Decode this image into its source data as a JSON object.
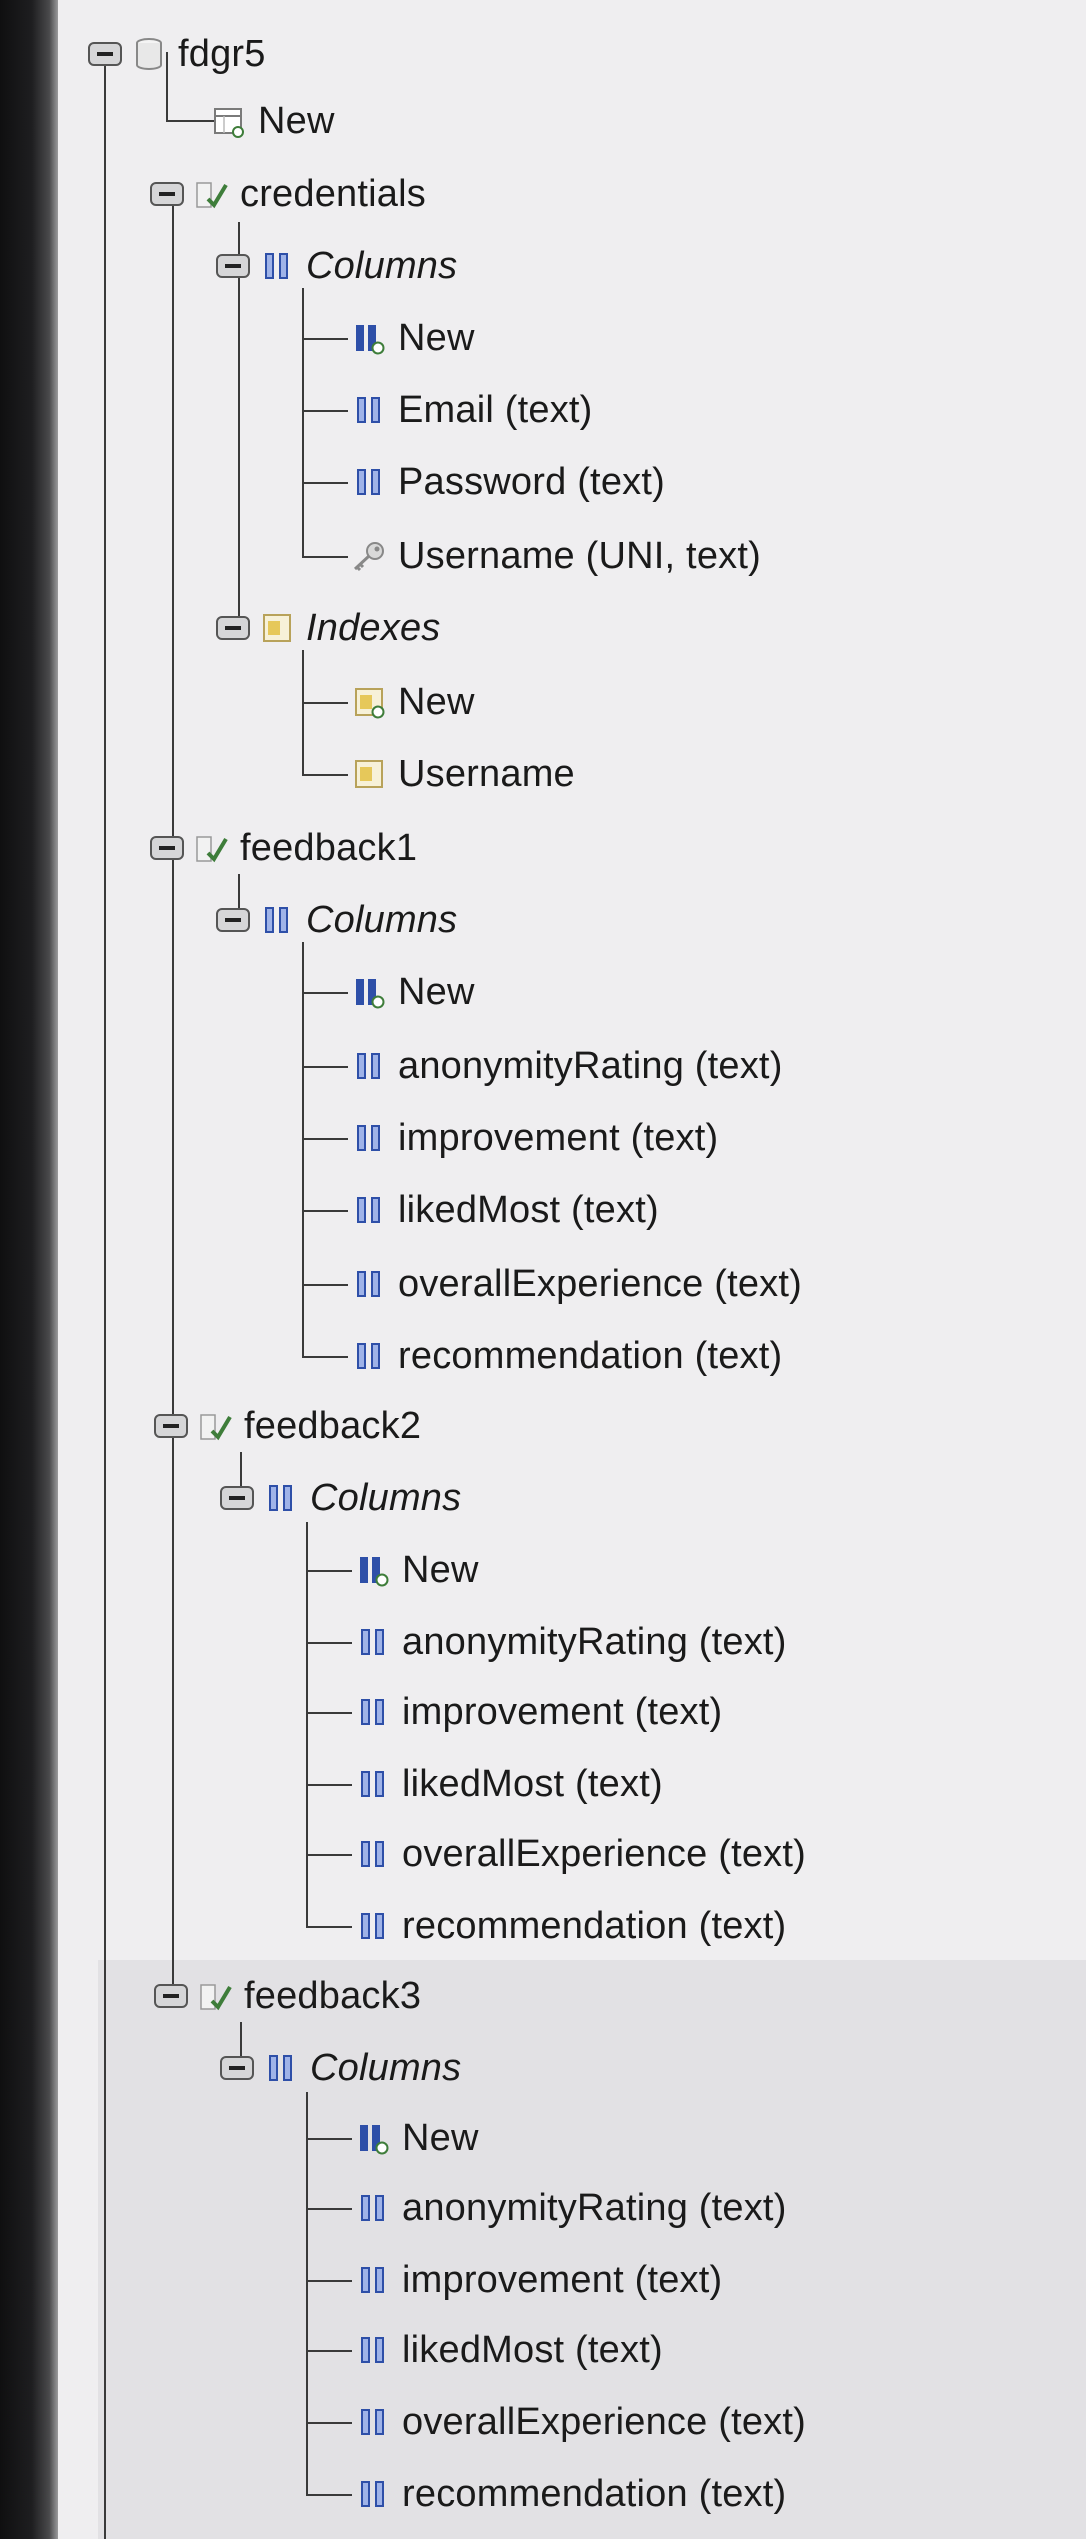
{
  "tree": {
    "root": {
      "label": "fdgr5"
    },
    "root_new": {
      "label": "New"
    },
    "tables": [
      {
        "name": "credentials",
        "columns_label": "Columns",
        "columns": [
          "New",
          "Email (text)",
          "Password (text)",
          "Username (UNI, text)"
        ],
        "indexes_label": "Indexes",
        "indexes": [
          "New",
          "Username"
        ]
      },
      {
        "name": "feedback1",
        "columns_label": "Columns",
        "columns": [
          "New",
          "anonymityRating (text)",
          "improvement (text)",
          "likedMost (text)",
          "overallExperience (text)",
          "recommendation (text)"
        ]
      },
      {
        "name": "feedback2",
        "columns_label": "Columns",
        "columns": [
          "New",
          "anonymityRating (text)",
          "improvement (text)",
          "likedMost (text)",
          "overallExperience (text)",
          "recommendation (text)"
        ]
      },
      {
        "name": "feedback3",
        "columns_label": "Columns",
        "columns": [
          "New",
          "anonymityRating (text)",
          "improvement (text)",
          "likedMost (text)",
          "overallExperience (text)",
          "recommendation (text)"
        ]
      }
    ]
  },
  "colors": {
    "line": "#3a3a3a",
    "column_icon": "#2e4fa8",
    "table_icon": "#3e7d3a",
    "index_icon": "#d8b84a"
  }
}
